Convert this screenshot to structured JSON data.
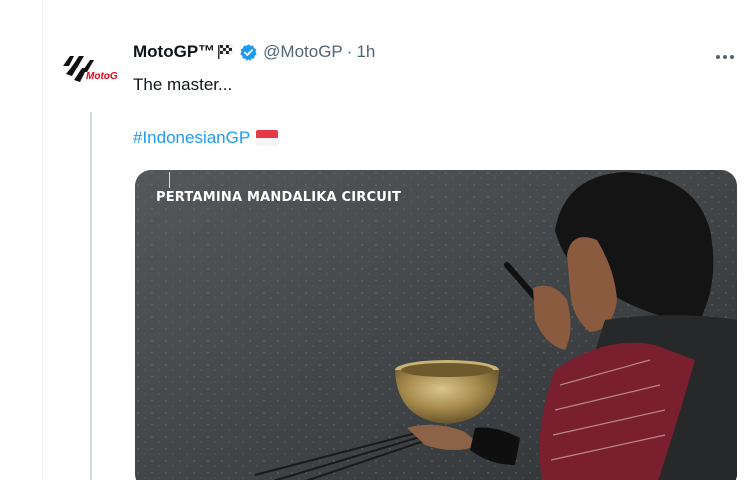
{
  "tweet": {
    "author_name": "MotoGP™",
    "handle": "@MotoGP",
    "separator": "·",
    "time": "1h",
    "text": "The master...",
    "more_icon": "more-horizontal-icon",
    "verified_icon": "verified-badge-icon",
    "name_flag_icon": "checkered-flag-icon"
  },
  "quoted": {
    "hashtag": "#IndonesianGP",
    "flag_icon": "indonesia-flag-icon",
    "media": {
      "caption": "PERTAMINA MANDALIKA CIRCUIT"
    }
  },
  "colors": {
    "link": "#1d9bf0",
    "muted": "#536471",
    "brand_red": "#e3051b"
  }
}
